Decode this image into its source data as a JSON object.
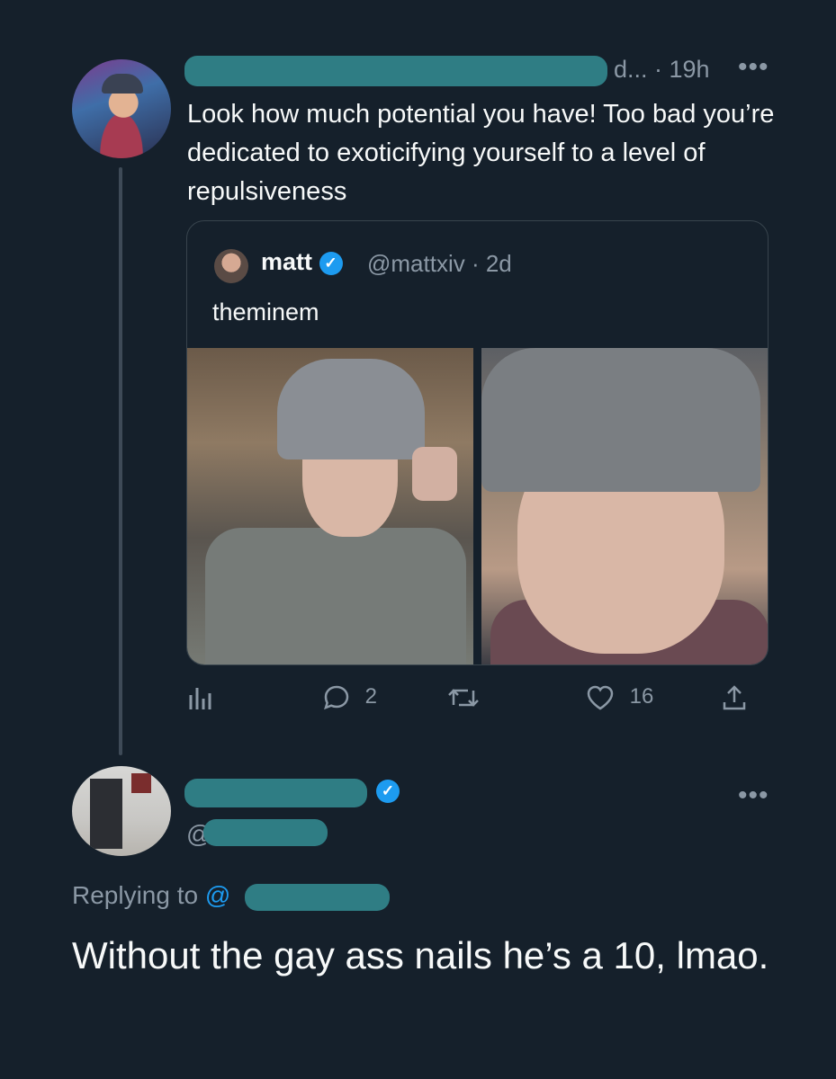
{
  "tweet": {
    "header_suffix": "d... · 19h",
    "more_label": "•••",
    "text": "Look how much potential you have! Too bad you’re dedicated to exoticifying yourself to a level of repulsiveness"
  },
  "quoted": {
    "name": "matt",
    "verified_glyph": "✓",
    "handle_time": "@mattxiv · 2d",
    "text": "theminem"
  },
  "actions": {
    "replies": "2",
    "likes": "16"
  },
  "reply": {
    "handle_prefix": "@",
    "verified_glyph": "✓",
    "more_label": "•••",
    "replying_to": "Replying to ",
    "replying_at": "@",
    "text": "Without the gay ass nails he’s a 10, lmao."
  },
  "colors": {
    "background": "#15202b",
    "accent": "#1d9bf0",
    "muted": "#8b98a5",
    "redaction": "#2f7d84"
  },
  "icons": [
    "analytics-icon",
    "reply-icon",
    "retweet-icon",
    "like-icon",
    "share-icon",
    "verified-icon",
    "more-icon"
  ]
}
